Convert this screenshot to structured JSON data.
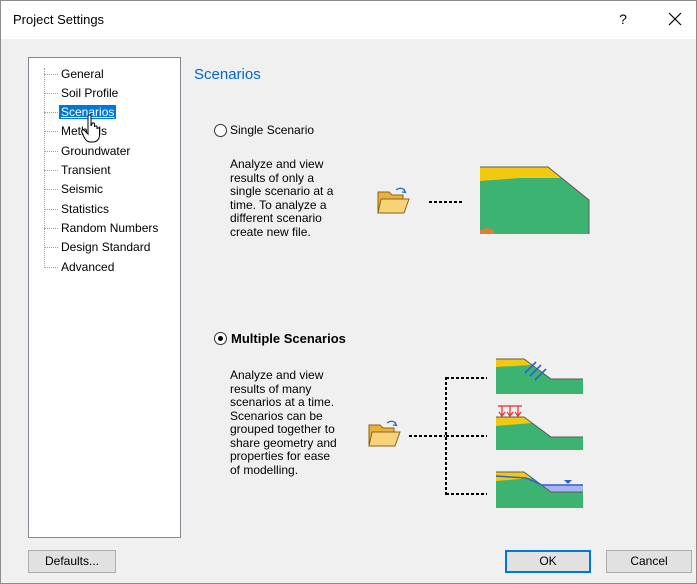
{
  "dialog": {
    "title": "Project Settings",
    "help_glyph": "?",
    "close_glyph": "✕"
  },
  "tree": {
    "items": [
      {
        "label": "General"
      },
      {
        "label": "Soil Profile"
      },
      {
        "label": "Scenarios",
        "selected": true
      },
      {
        "label": "Methods"
      },
      {
        "label": "Groundwater"
      },
      {
        "label": "Transient"
      },
      {
        "label": "Seismic"
      },
      {
        "label": "Statistics"
      },
      {
        "label": "Random Numbers"
      },
      {
        "label": "Design Standard"
      },
      {
        "label": "Advanced"
      }
    ]
  },
  "main": {
    "section_title": "Scenarios",
    "single": {
      "label": "Single Scenario",
      "checked": false,
      "description": "Analyze and view\nresults of only a\nsingle scenario at a\ntime. To analyze a\ndifferent scenario\ncreate new file."
    },
    "multiple": {
      "label": "Multiple Scenarios",
      "checked": true,
      "description": "Analyze and view\nresults of many\nscenarios at a time.\nScenarios can be\ngrouped together to\nshare geometry and\nproperties for ease\nof modelling."
    }
  },
  "footer": {
    "defaults_label": "Defaults...",
    "ok_label": "OK",
    "cancel_label": "Cancel"
  },
  "colors": {
    "accent": "#0078d7",
    "section_title": "#0066cc",
    "soil_green": "#3cb371",
    "soil_yellow": "#f2c811",
    "water_blue": "#2f5fd0",
    "load_red": "#e03030"
  }
}
